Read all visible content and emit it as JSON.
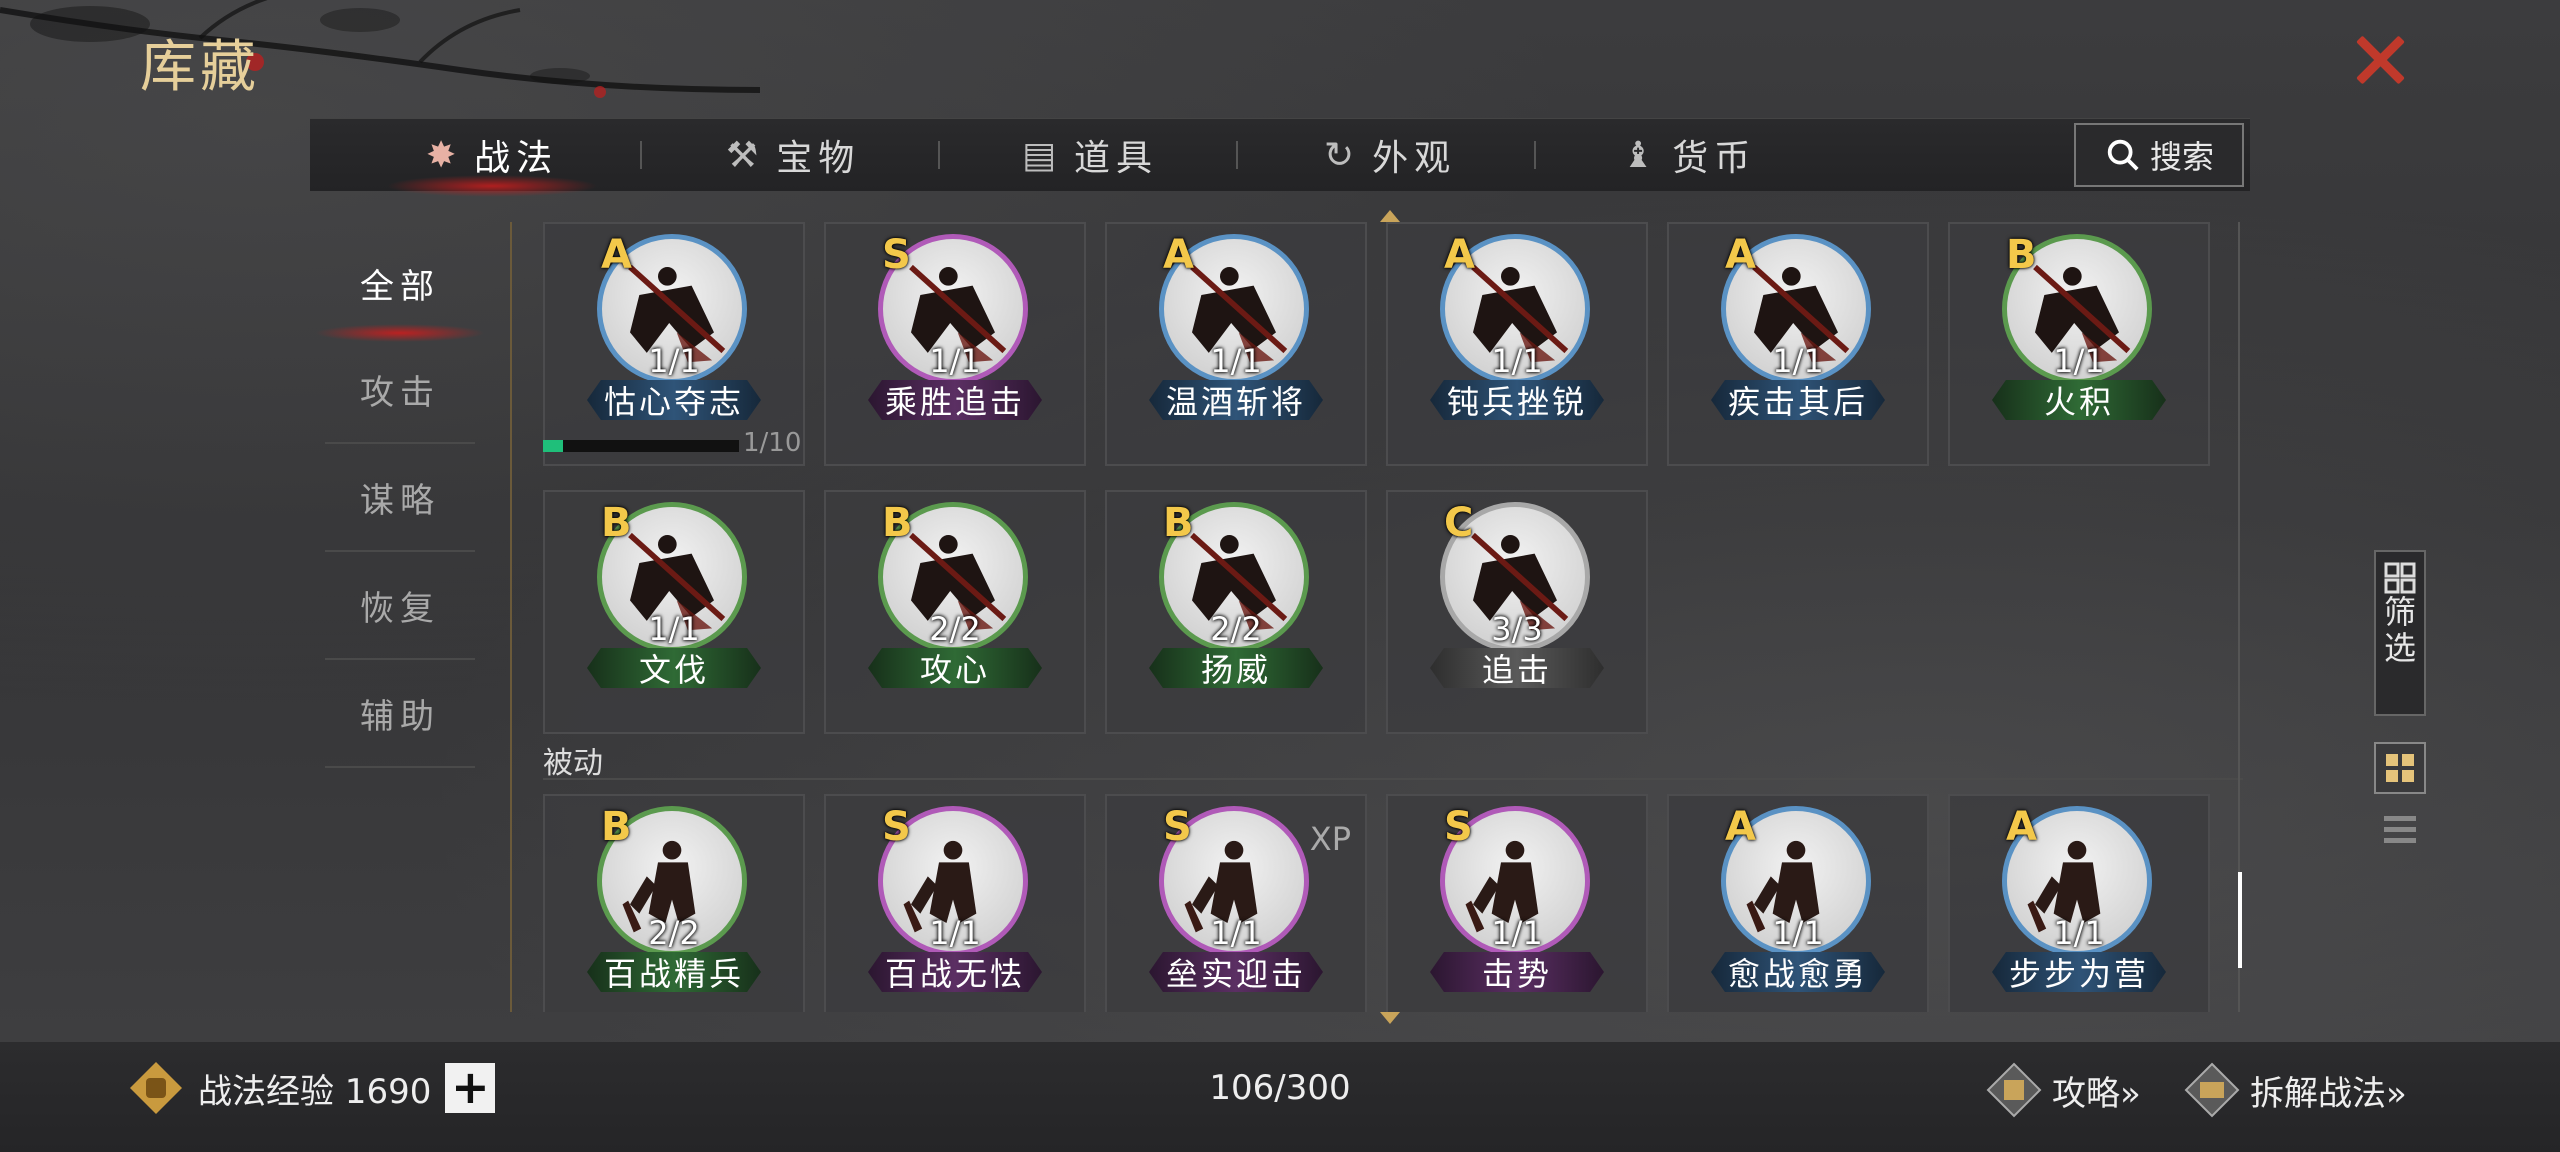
{
  "title": "库藏",
  "tabs": [
    {
      "label": "战法",
      "icon": "scroll-bundle-icon",
      "active": true
    },
    {
      "label": "宝物",
      "icon": "treasure-icon",
      "active": false
    },
    {
      "label": "道具",
      "icon": "item-box-icon",
      "active": false
    },
    {
      "label": "外观",
      "icon": "appearance-icon",
      "active": false
    },
    {
      "label": "货币",
      "icon": "money-bag-icon",
      "active": false
    }
  ],
  "search_label": "搜索",
  "categories": [
    {
      "label": "全部",
      "active": true
    },
    {
      "label": "攻击",
      "active": false
    },
    {
      "label": "谋略",
      "active": false
    },
    {
      "label": "恢复",
      "active": false
    },
    {
      "label": "辅助",
      "active": false
    }
  ],
  "active_skills": [
    {
      "grade": "A",
      "count": "1/1",
      "name": "怙心夺志",
      "ring": "#5a92c4"
    },
    {
      "grade": "S",
      "count": "1/1",
      "name": "乘胜追击",
      "ring": "#b05ab8"
    },
    {
      "grade": "A",
      "count": "1/1",
      "name": "温酒斩将",
      "ring": "#5a92c4"
    },
    {
      "grade": "A",
      "count": "1/1",
      "name": "钝兵挫锐",
      "ring": "#5a92c4"
    },
    {
      "grade": "A",
      "count": "1/1",
      "name": "疾击其后",
      "ring": "#5a92c4"
    },
    {
      "grade": "B",
      "count": "1/1",
      "name": "火积",
      "ring": "#5b9a4e"
    },
    {
      "grade": "B",
      "count": "1/1",
      "name": "文伐",
      "ring": "#5b9a4e"
    },
    {
      "grade": "B",
      "count": "2/2",
      "name": "攻心",
      "ring": "#5b9a4e"
    },
    {
      "grade": "B",
      "count": "2/2",
      "name": "扬威",
      "ring": "#5b9a4e"
    },
    {
      "grade": "C",
      "count": "3/3",
      "name": "追击",
      "ring": "#a8a8a8"
    }
  ],
  "progress": {
    "text": "1/10",
    "value": 0.1
  },
  "passive_label": "被动",
  "passive_skills": [
    {
      "grade": "B",
      "count": "2/2",
      "name": "百战精兵",
      "ring": "#5b9a4e",
      "xp": ""
    },
    {
      "grade": "S",
      "count": "1/1",
      "name": "百战无怯",
      "ring": "#b05ab8",
      "xp": ""
    },
    {
      "grade": "S",
      "count": "1/1",
      "name": "垒实迎击",
      "ring": "#b05ab8",
      "xp": "XP"
    },
    {
      "grade": "S",
      "count": "1/1",
      "name": "击势",
      "ring": "#b05ab8",
      "xp": ""
    },
    {
      "grade": "A",
      "count": "1/1",
      "name": "愈战愈勇",
      "ring": "#5a92c4",
      "xp": ""
    },
    {
      "grade": "A",
      "count": "1/1",
      "name": "步步为营",
      "ring": "#5a92c4",
      "xp": ""
    }
  ],
  "filter_label": "筛选",
  "exp_label": "战法经验 1690",
  "total": "106/300",
  "guide_label": "攻略»",
  "dismantle_label": "拆解战法»",
  "colors": {
    "title": "#e6cf9a",
    "grade": "#f3c84a",
    "close": "#c0392b"
  }
}
